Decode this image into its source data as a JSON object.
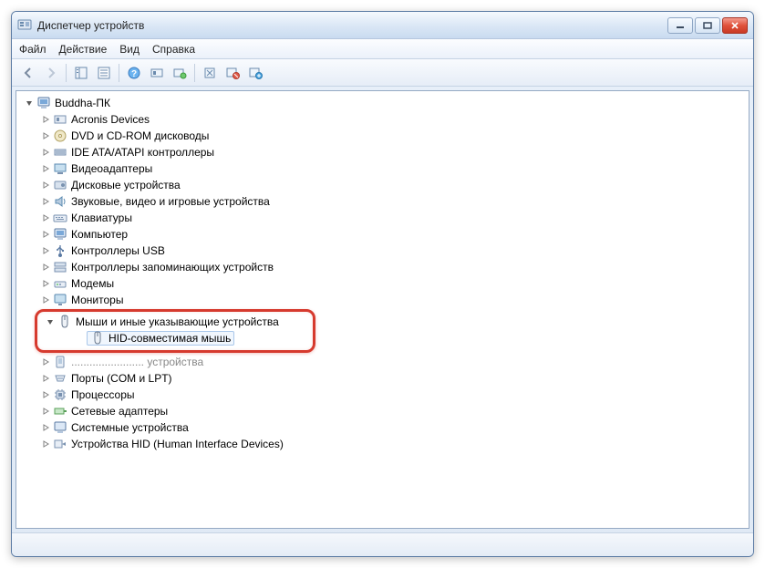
{
  "window": {
    "title": "Диспетчер устройств"
  },
  "menu": {
    "file": "Файл",
    "action": "Действие",
    "view": "Вид",
    "help": "Справка"
  },
  "tree": {
    "root": "Buddha-ПК",
    "nodes": {
      "acronis": "Acronis Devices",
      "dvd": "DVD и CD-ROM дисководы",
      "ide": "IDE ATA/ATAPI контроллеры",
      "video": "Видеоадаптеры",
      "disk": "Дисковые устройства",
      "sound": "Звуковые, видео и игровые устройства",
      "keyboard": "Клавиатуры",
      "computer": "Компьютер",
      "usb": "Контроллеры USB",
      "storage": "Контроллеры запоминающих устройств",
      "modem": "Модемы",
      "monitor": "Мониторы",
      "mouse": "Мыши и иные указывающие устройства",
      "mouse_child": "HID-совместимая мышь",
      "portable_partial": "........................ устройства",
      "ports": "Порты (COM и LPT)",
      "cpu": "Процессоры",
      "network": "Сетевые адаптеры",
      "system": "Системные устройства",
      "hid": "Устройства HID (Human Interface Devices)"
    }
  }
}
